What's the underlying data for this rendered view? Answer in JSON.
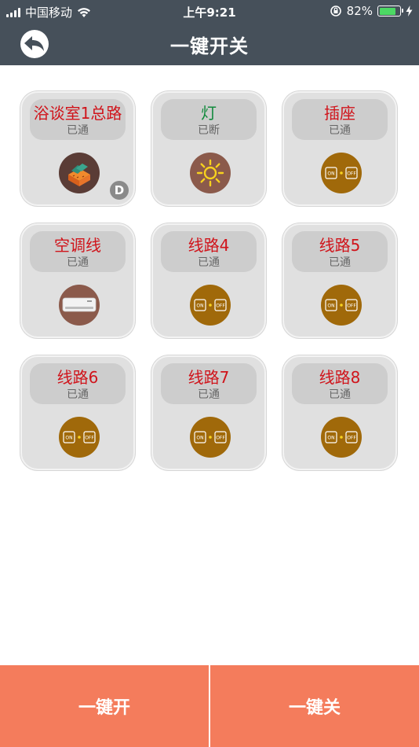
{
  "status_bar": {
    "carrier": "中国移动",
    "time": "上午9:21",
    "battery": "82%",
    "battery_level": 0.82
  },
  "header": {
    "title": "一键开关",
    "back_icon": "back-arrow-icon"
  },
  "colors": {
    "header_bg": "#46505a",
    "tile_bg": "#e0e0e0",
    "label_bg": "#cdcdcd",
    "on_text": "#d0141b",
    "off_text": "#118a3c",
    "button_bg": "#f47c5c",
    "switch_circle": "#a0690a",
    "appliance_circle": "#8b5a4b"
  },
  "tiles": [
    {
      "name": "浴谈室1总路",
      "status": "已通",
      "state": "on",
      "icon": "bath-toiletries-icon",
      "badge": "D"
    },
    {
      "name": "灯",
      "status": "已断",
      "state": "off",
      "icon": "light-sun-icon"
    },
    {
      "name": "插座",
      "status": "已通",
      "state": "on",
      "icon": "on-off-switch-icon"
    },
    {
      "name": "空调线",
      "status": "已通",
      "state": "on",
      "icon": "air-conditioner-icon"
    },
    {
      "name": "线路4",
      "status": "已通",
      "state": "on",
      "icon": "on-off-switch-icon"
    },
    {
      "name": "线路5",
      "status": "已通",
      "state": "on",
      "icon": "on-off-switch-icon"
    },
    {
      "name": "线路6",
      "status": "已通",
      "state": "on",
      "icon": "on-off-switch-icon"
    },
    {
      "name": "线路7",
      "status": "已通",
      "state": "on",
      "icon": "on-off-switch-icon"
    },
    {
      "name": "线路8",
      "status": "已通",
      "state": "on",
      "icon": "on-off-switch-icon"
    }
  ],
  "switch_icon_text": {
    "on": "ON",
    "off": "OFF"
  },
  "bottom": {
    "all_on": "一键开",
    "all_off": "一键关"
  }
}
